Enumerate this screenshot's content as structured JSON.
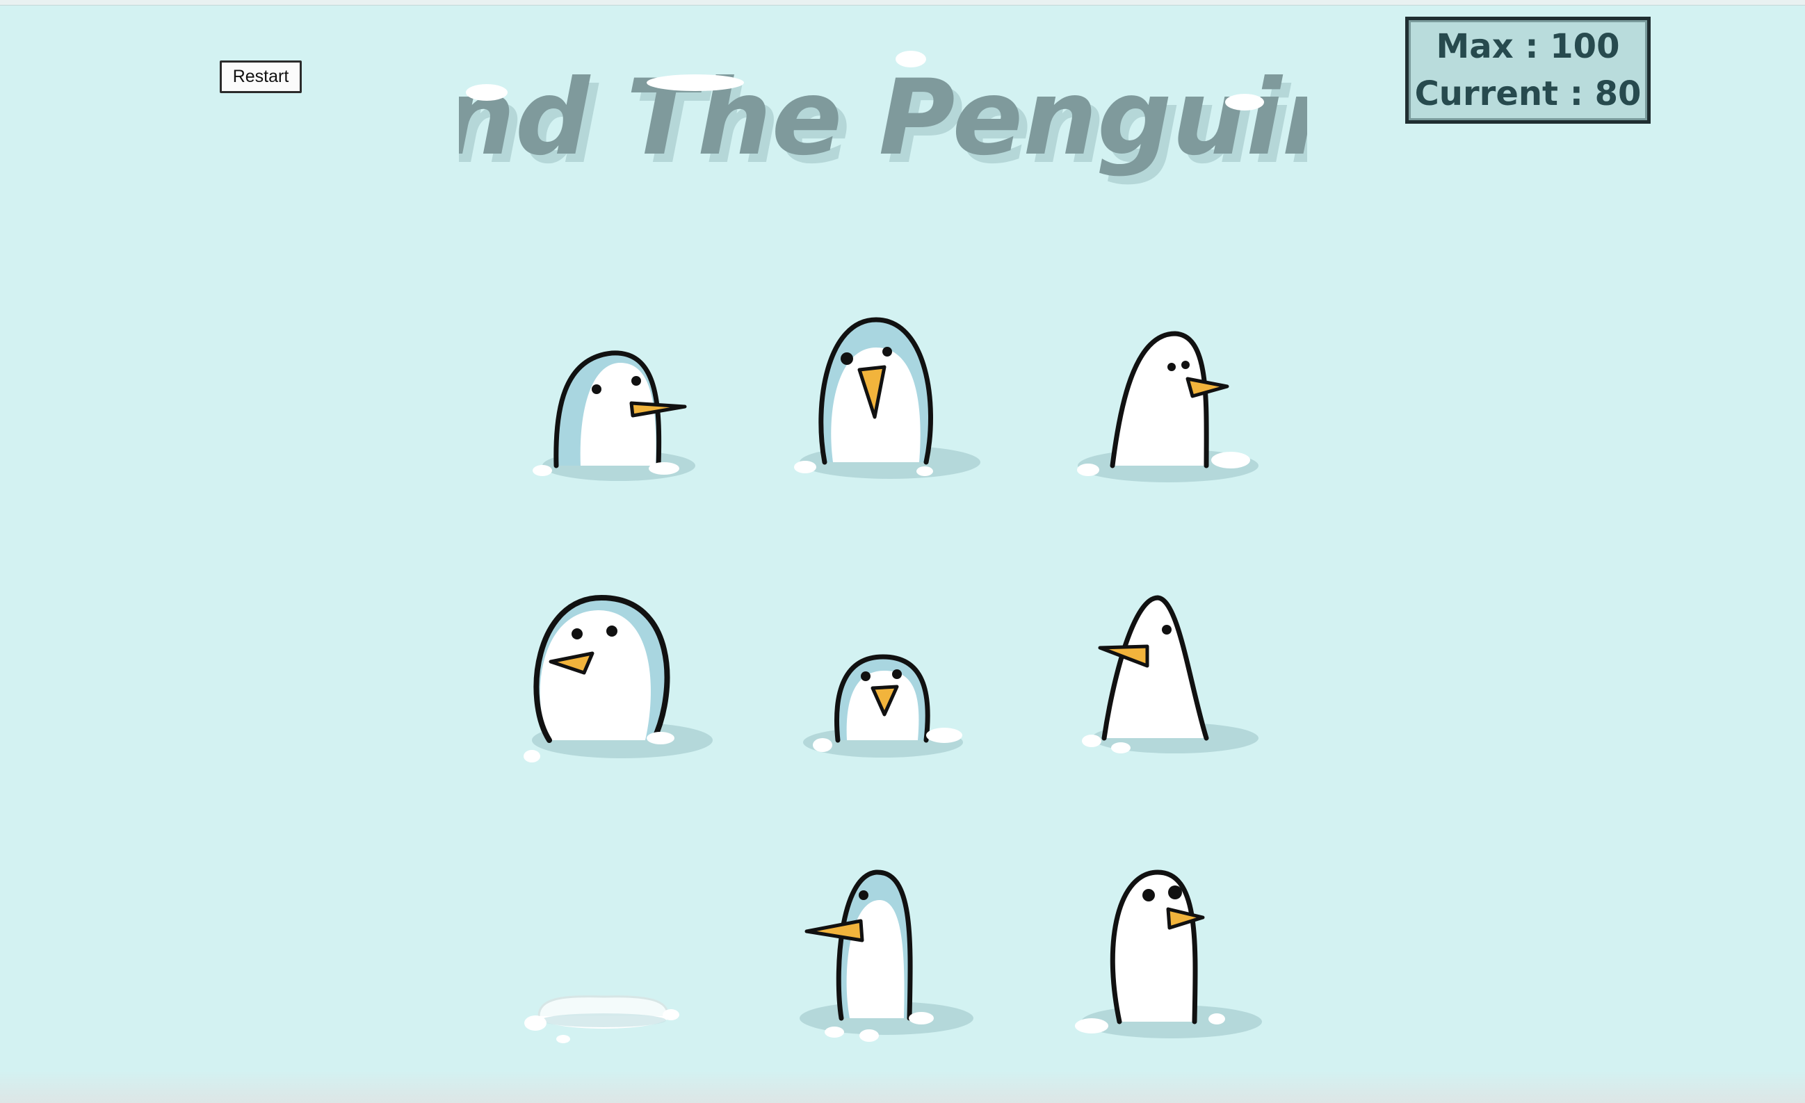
{
  "game": {
    "title": "Find The Penguins",
    "restart_label": "Restart",
    "score": {
      "max_label": "Max : 100",
      "current_label": "Current : 80"
    },
    "grid": {
      "rows": 3,
      "columns": 3,
      "cells": [
        {
          "state": "penguin",
          "facing": "right"
        },
        {
          "state": "penguin",
          "facing": "front"
        },
        {
          "state": "penguin",
          "facing": "right"
        },
        {
          "state": "penguin",
          "facing": "left"
        },
        {
          "state": "penguin",
          "facing": "front"
        },
        {
          "state": "penguin",
          "facing": "left"
        },
        {
          "state": "empty-hole",
          "facing": "none"
        },
        {
          "state": "penguin",
          "facing": "left"
        },
        {
          "state": "penguin",
          "facing": "right"
        }
      ]
    }
  },
  "colors": {
    "background": "#d3f2f2",
    "penguin_outline": "#111111",
    "penguin_body": "#ffffff",
    "penguin_back": "#a9d6e0",
    "beak": "#f2b43c",
    "hole_shadow": "#a9cfd2",
    "title_text": "#7f9a9c",
    "score_text": "#274a4e"
  }
}
